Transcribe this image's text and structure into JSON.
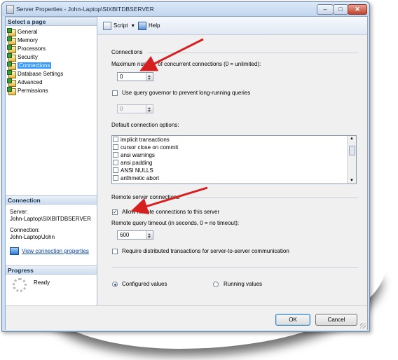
{
  "window": {
    "title": "Server Properties - John-Laptop\\SIXBITDBSERVER"
  },
  "left": {
    "select_page_header": "Select a page",
    "pages": [
      {
        "label": "General",
        "selected": false
      },
      {
        "label": "Memory",
        "selected": false
      },
      {
        "label": "Processors",
        "selected": false
      },
      {
        "label": "Security",
        "selected": false
      },
      {
        "label": "Connections",
        "selected": true
      },
      {
        "label": "Database Settings",
        "selected": false
      },
      {
        "label": "Advanced",
        "selected": false
      },
      {
        "label": "Permissions",
        "selected": false
      }
    ],
    "connection_header": "Connection",
    "server_label": "Server:",
    "server_value": "John-Laptop\\SIXBITDBSERVER",
    "connection_label": "Connection:",
    "connection_value": "John-Laptop\\John",
    "view_link": "View connection properties",
    "progress_header": "Progress",
    "progress_status": "Ready"
  },
  "toolbar": {
    "script_label": "Script",
    "help_label": "Help"
  },
  "connections": {
    "section_title": "Connections",
    "max_concurrent_label": "Maximum number of concurrent connections (0 = unlimited):",
    "max_concurrent_value": "0",
    "query_governor_label": "Use query governor to prevent long-running queries",
    "query_governor_checked": false,
    "query_governor_value": "0",
    "default_options_label": "Default connection options:",
    "options": [
      {
        "label": "implicit transactions",
        "checked": false
      },
      {
        "label": "cursor close on commit",
        "checked": false
      },
      {
        "label": "ansi warnings",
        "checked": false
      },
      {
        "label": "ansi padding",
        "checked": false
      },
      {
        "label": "ANSI NULLS",
        "checked": false
      },
      {
        "label": "arithmetic abort",
        "checked": false
      }
    ]
  },
  "remote": {
    "section_title": "Remote server connections",
    "allow_label": "Allow remote connections to this server",
    "allow_checked": true,
    "timeout_label": "Remote query timeout (in seconds, 0 = no timeout):",
    "timeout_value": "600",
    "require_dtc_label": "Require distributed transactions for server-to-server communication",
    "require_dtc_checked": false
  },
  "values_mode": {
    "configured_label": "Configured values",
    "running_label": "Running values",
    "selected": "configured"
  },
  "buttons": {
    "ok": "OK",
    "cancel": "Cancel"
  },
  "colors": {
    "selection": "#3399ff",
    "arrow": "#d62020",
    "link": "#0645ad"
  }
}
